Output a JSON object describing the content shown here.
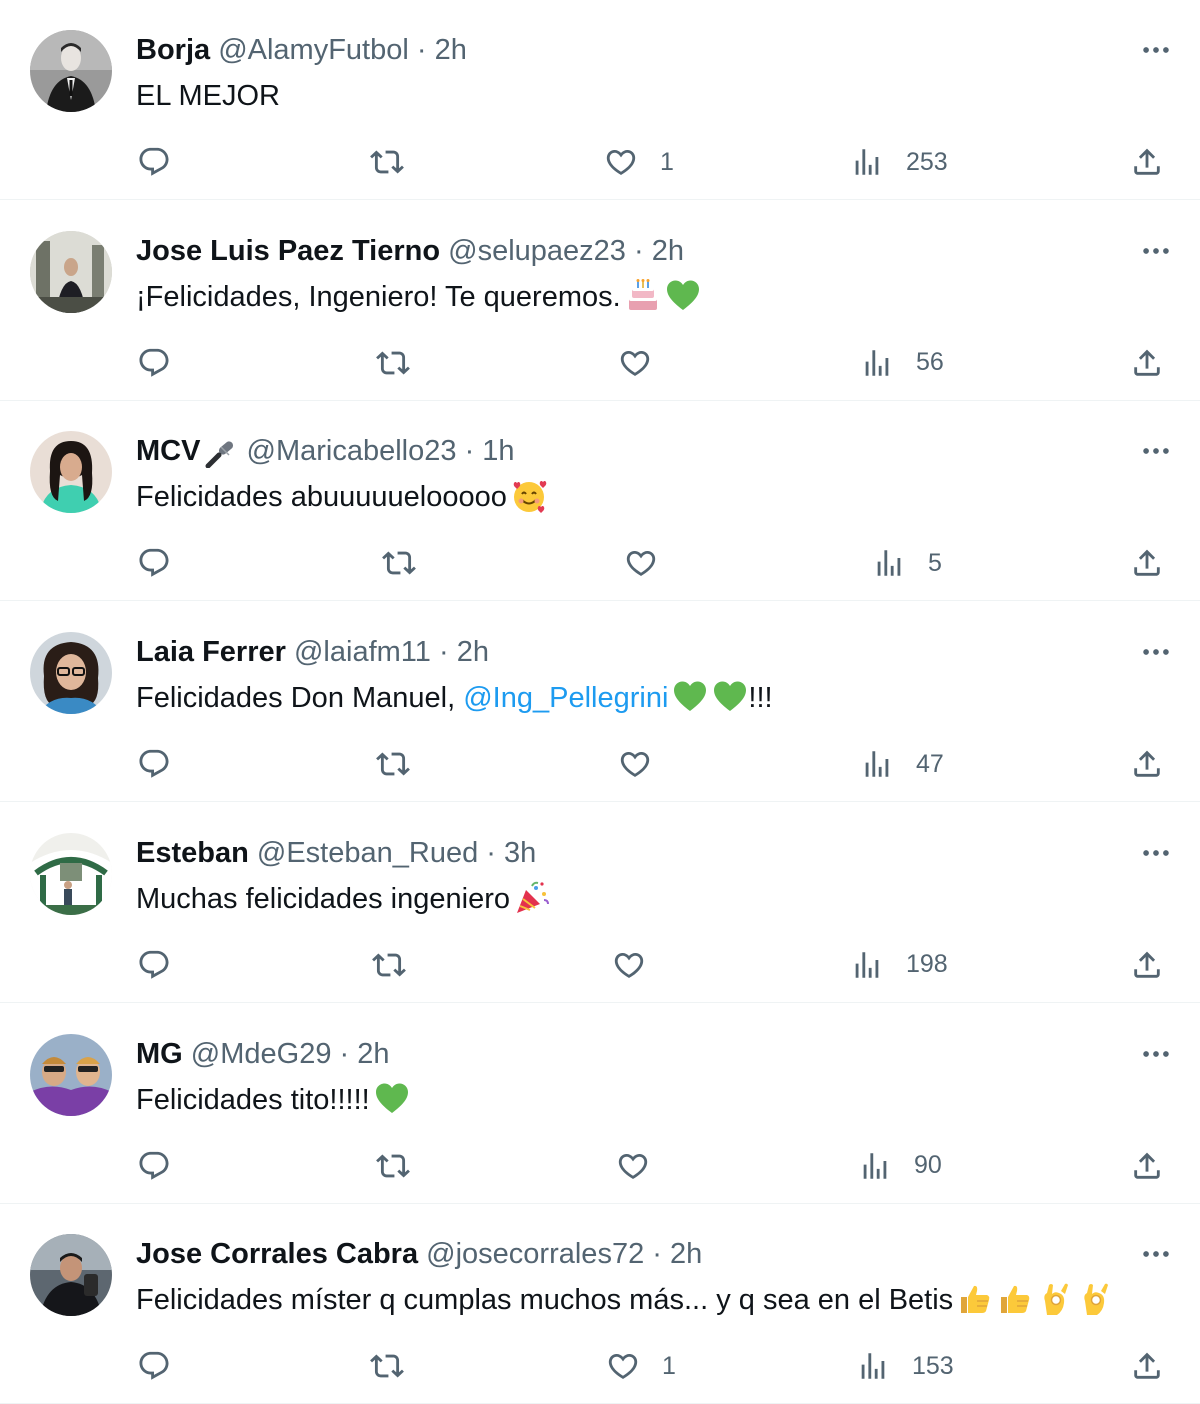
{
  "tweets": [
    {
      "name": "Borja",
      "handle": "@AlamyFutbol",
      "time": "2h",
      "text": "EL MEJOR",
      "likes": "1",
      "views": "253",
      "pos": {
        "reply": 137,
        "retweet": 370,
        "like": 604,
        "views": 850,
        "share": 1130
      }
    },
    {
      "name": "Jose Luis Paez Tierno",
      "handle": "@selupaez23",
      "time": "2h",
      "text": "¡Felicidades, Ingeniero! Te queremos.",
      "emojis": [
        "cake",
        "green-heart"
      ],
      "likes": "",
      "views": "56",
      "pos": {
        "reply": 137,
        "retweet": 376,
        "like": 618,
        "views": 860,
        "share": 1130
      }
    },
    {
      "name": "MCV",
      "handle": "@Maricabello23",
      "time": "1h",
      "text": "Felicidades abuuuuuelooooo",
      "emojis": [
        "smiling-face-with-hearts"
      ],
      "name_badge": "microphone",
      "likes": "",
      "views": "5",
      "pos": {
        "reply": 137,
        "retweet": 382,
        "like": 624,
        "views": 872,
        "share": 1130
      }
    },
    {
      "name": "Laia Ferrer",
      "handle": "@laiafm11",
      "time": "2h",
      "text": "Felicidades Don Manuel, ",
      "mention": "@Ing_Pellegrini",
      "emojis": [
        "green-heart",
        "green-heart"
      ],
      "suffix": "!!!",
      "likes": "",
      "views": "47",
      "pos": {
        "reply": 137,
        "retweet": 376,
        "like": 618,
        "views": 860,
        "share": 1130
      }
    },
    {
      "name": "Esteban",
      "handle": "@Esteban_Rued",
      "time": "3h",
      "text": "Muchas felicidades ingeniero",
      "emojis": [
        "party-popper"
      ],
      "likes": "",
      "views": "198",
      "pos": {
        "reply": 137,
        "retweet": 372,
        "like": 612,
        "views": 850,
        "share": 1130
      }
    },
    {
      "name": "MG",
      "handle": "@MdeG29",
      "time": "2h",
      "text": "Felicidades tito!!!!!",
      "emojis": [
        "green-heart"
      ],
      "likes": "",
      "views": "90",
      "pos": {
        "reply": 137,
        "retweet": 376,
        "like": 616,
        "views": 858,
        "share": 1130
      }
    },
    {
      "name": "Jose Corrales Cabra",
      "handle": "@josecorrales72",
      "time": "2h",
      "text": "Felicidades míster q cumplas muchos más... y q sea en el Betis",
      "emojis": [
        "thumbs-up",
        "thumbs-up",
        "ok-hand",
        "ok-hand"
      ],
      "likes": "1",
      "views": "153",
      "pos": {
        "reply": 137,
        "retweet": 370,
        "like": 606,
        "views": 856,
        "share": 1130
      }
    }
  ],
  "icons": {
    "reply": "reply-icon",
    "retweet": "retweet-icon",
    "like": "heart-icon",
    "views": "views-icon",
    "share": "share-icon",
    "more": "more-icon"
  },
  "colors": {
    "text": "#0f1419",
    "secondary": "#536471",
    "link": "#1d9bf0",
    "divider": "#eff3f4"
  }
}
